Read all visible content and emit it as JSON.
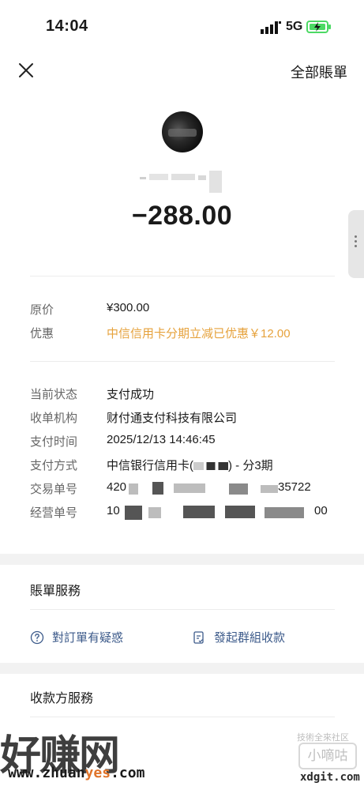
{
  "status_bar": {
    "time": "14:04",
    "network": "5G"
  },
  "header": {
    "close_icon": "close-icon",
    "all_bills": "全部賬單"
  },
  "merchant": {
    "amount": "−288.00"
  },
  "price_section": {
    "original_label": "原价",
    "original_value": "¥300.00",
    "discount_label": "优惠",
    "discount_value": "中信信用卡分期立减已优惠￥12.00"
  },
  "details": [
    {
      "label": "当前状态",
      "value": "支付成功"
    },
    {
      "label": "收单机构",
      "value": "财付通支付科技有限公司"
    },
    {
      "label": "支付时间",
      "value": "2025/12/13 14:46:45"
    },
    {
      "label": "支付方式",
      "value_prefix": "中信银行信用卡(",
      "value_suffix": ") - 分3期"
    },
    {
      "label": "交易单号",
      "value_start": "420",
      "value_end": "35722"
    },
    {
      "label": "经营单号",
      "value_start": "10",
      "value_end": "00"
    }
  ],
  "bill_services": {
    "title": "賬單服務",
    "doubt": {
      "label": "對訂單有疑惑",
      "icon": "question-circle-icon"
    },
    "group": {
      "label": "發起群組收款",
      "icon": "document-check-icon"
    }
  },
  "payee_services": {
    "title": "收款方服務"
  },
  "watermark": {
    "big_text": "好赚网",
    "url_prefix": "www.zhuan",
    "url_highlight": "yes",
    "url_suffix": ".com",
    "small_caption": "技術全來社区",
    "logo_text": "小嘀咕",
    "domain2": "xdgit.com"
  },
  "colors": {
    "promo": "#e6a23c",
    "link": "#3c5a8a",
    "section_gap": "#f2f2f2"
  }
}
